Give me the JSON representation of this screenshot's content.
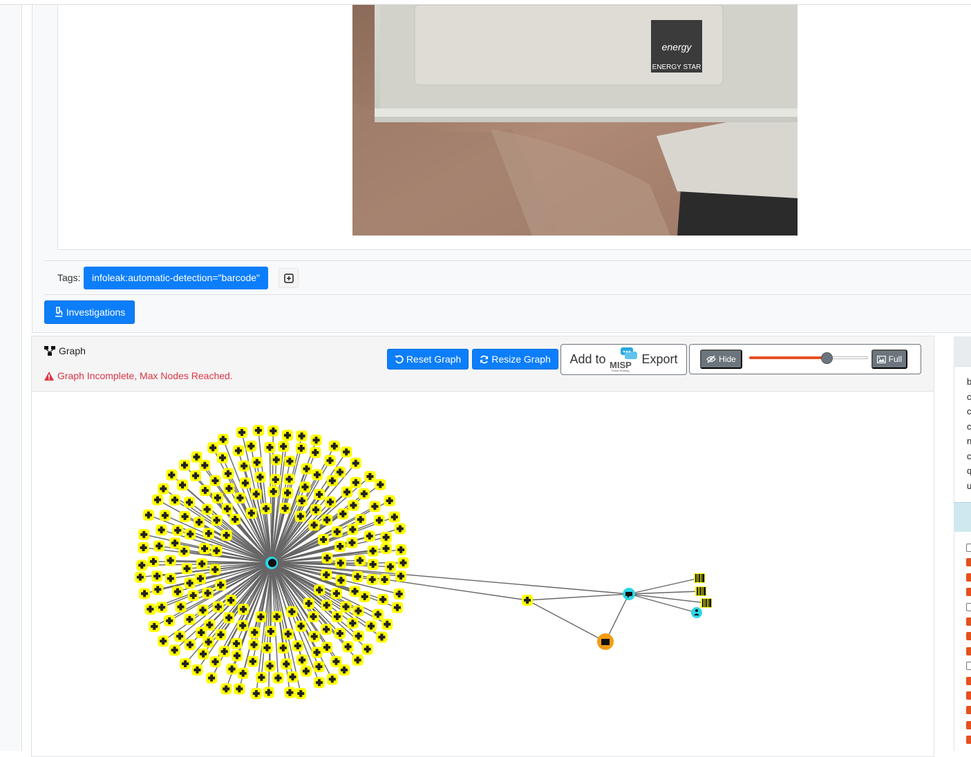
{
  "tags": {
    "label": "Tags:",
    "items": [
      "infoleak:automatic-detection=\"barcode\""
    ]
  },
  "investigations": {
    "label": "Investigations"
  },
  "graph": {
    "title": "Graph",
    "warning": "Graph Incomplete, Max Nodes Reached.",
    "reset_label": "Reset Graph",
    "resize_label": "Resize Graph",
    "misp": {
      "add_to": "Add to",
      "logo_text": "MISP",
      "logo_sub": "Threat Sharing",
      "export": "Export"
    },
    "hide_label": "Hide",
    "full_label": "Full",
    "slider_value": 0.65
  },
  "photo": {
    "logo_script": "energy",
    "logo_text": "ENERGY STAR"
  },
  "right_panel": {
    "letters": [
      "b",
      "c",
      "c",
      "c",
      "n",
      "c",
      "q",
      "u"
    ],
    "checkboxes": [
      false,
      true,
      true,
      true,
      false,
      true,
      true,
      true,
      false,
      true,
      true,
      true,
      true,
      true
    ]
  },
  "colors": {
    "primary": "#0d7ef9",
    "danger": "#dc3545",
    "secondary": "#6c757d",
    "slider": "#e6501e",
    "node_yellow": "#ffff00",
    "node_image": "#f39c12",
    "node_cyan": "#2ed6e6"
  }
}
